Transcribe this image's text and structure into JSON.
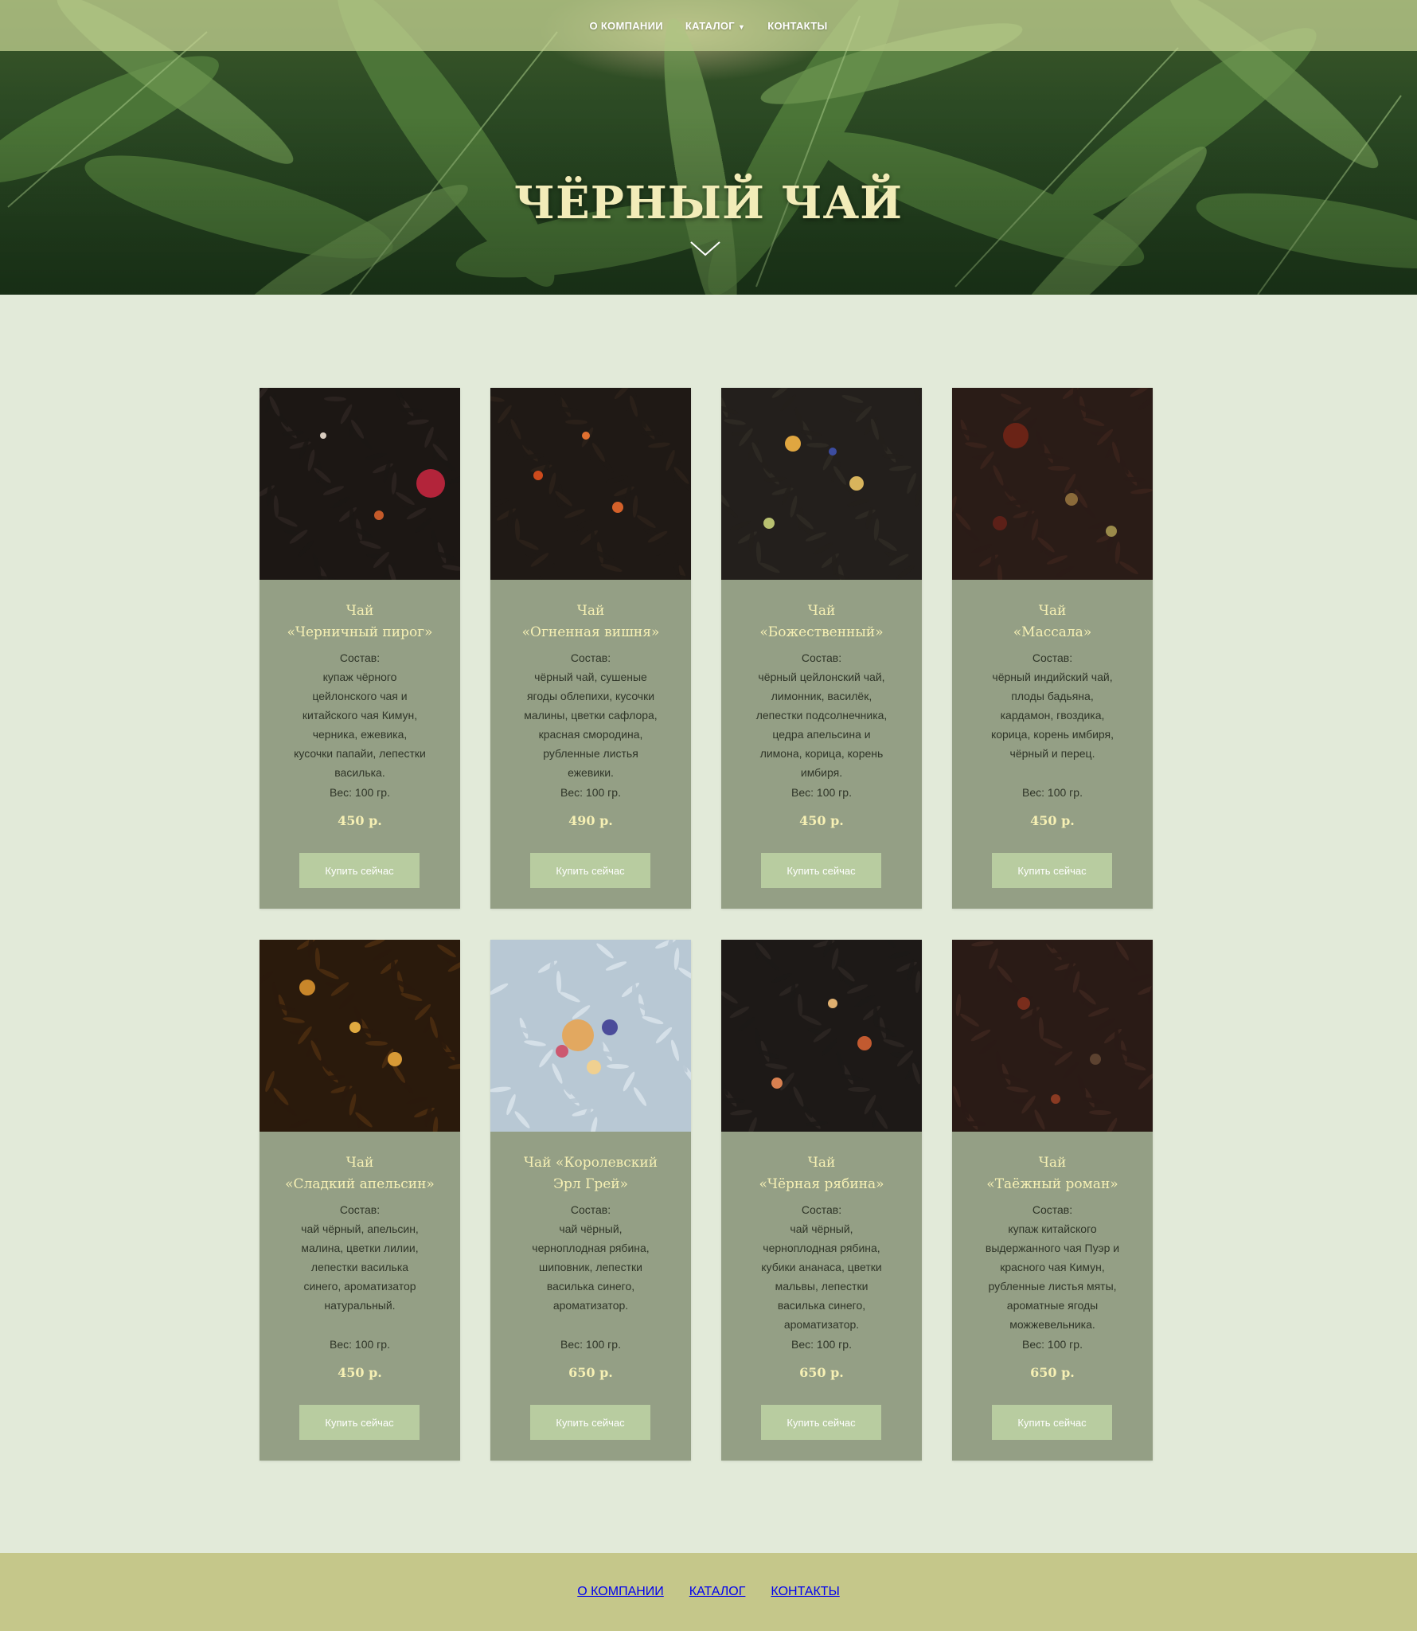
{
  "nav": {
    "about": "О КОМПАНИИ",
    "catalog": "КАТАЛОГ",
    "contacts": "КОНТАКТЫ"
  },
  "hero": {
    "title": "ЧЁРНЫЙ ЧАЙ"
  },
  "icons": {
    "caret": "caret-down-icon",
    "scroll": "chevron-down-icon"
  },
  "colors": {
    "page_bg": "#e2ead9",
    "card_bg": "#949f85",
    "accent_text": "#f6f0b4",
    "button_bg": "#b8cca0",
    "footer_bg": "#c5c78a"
  },
  "products": [
    {
      "name": "Чай\n«Черничный пирог»",
      "composition": "Состав:\nкупаж чёрного\nцейлонского чая и\nкитайского чая Кимун,\nчерника, ежевика,\nкусочки папайи, лепестки\nвасилька.",
      "weight": "Вес: 100 гр.",
      "price": "450 р.",
      "button": "Купить сейчас"
    },
    {
      "name": "Чай\n«Огненная вишня»",
      "composition": "Состав:\nчёрный чай, сушеные\nягоды облепихи, кусочки\nмалины, цветки сафлора,\nкрасная смородина,\nрубленные листья\nежевики.",
      "weight": "Вес: 100 гр.",
      "price": "490 р.",
      "button": "Купить сейчас"
    },
    {
      "name": "Чай\n«Божественный»",
      "composition": "Состав:\nчёрный цейлонский чай,\nлимонник, василёк,\nлепестки подсолнечника,\nцедра апельсина и\nлимона, корица, корень\nимбиря.",
      "weight": "Вес: 100 гр.",
      "price": "450 р.",
      "button": "Купить сейчас"
    },
    {
      "name": "Чай\n«Массала»",
      "composition": "Состав:\nчёрный индийский чай,\nплоды бадьяна,\nкардамон, гвоздика,\nкорица, корень имбиря,\nчёрный и перец.",
      "weight": "Вес: 100 гр.",
      "price": "450 р.",
      "button": "Купить сейчас"
    },
    {
      "name": "Чай\n«Сладкий апельсин»",
      "composition": "Состав:\nчай чёрный, апельсин,\nмалина, цветки лилии,\nлепестки василька\nсинего, ароматизатор\nнатуральный.",
      "weight": "Вес: 100 гр.",
      "price": "450 р.",
      "button": "Купить сейчас"
    },
    {
      "name": "Чай «Королевский\nЭрл Грей»",
      "composition": "Состав:\nчай чёрный,\nчерноплодная рябина,\nшиповник, лепестки\nвасилька синего,\nароматизатор.",
      "weight": "Вес: 100 гр.",
      "price": "650 р.",
      "button": "Купить сейчас"
    },
    {
      "name": "Чай\n«Чёрная рябина»",
      "composition": "Состав:\nчай чёрный,\nчерноплодная рябина,\nкубики ананаса, цветки\nмальвы, лепестки\nвасилька синего,\nароматизатор.",
      "weight": "Вес: 100 гр.",
      "price": "650 р.",
      "button": "Купить сейчас"
    },
    {
      "name": "Чай\n«Таёжный роман»",
      "composition": "Состав:\nкупаж китайского\nвыдержанного чая Пуэр и\nкрасного чая Кимун,\nрубленные листья мяты,\nароматные ягоды\nможжевельника.",
      "weight": "Вес: 100 гр.",
      "price": "650 р.",
      "button": "Купить сейчас"
    }
  ],
  "footer": {
    "about": "О КОМПАНИИ",
    "catalog": "КАТАЛОГ",
    "contacts": "КОНТАКТЫ"
  }
}
